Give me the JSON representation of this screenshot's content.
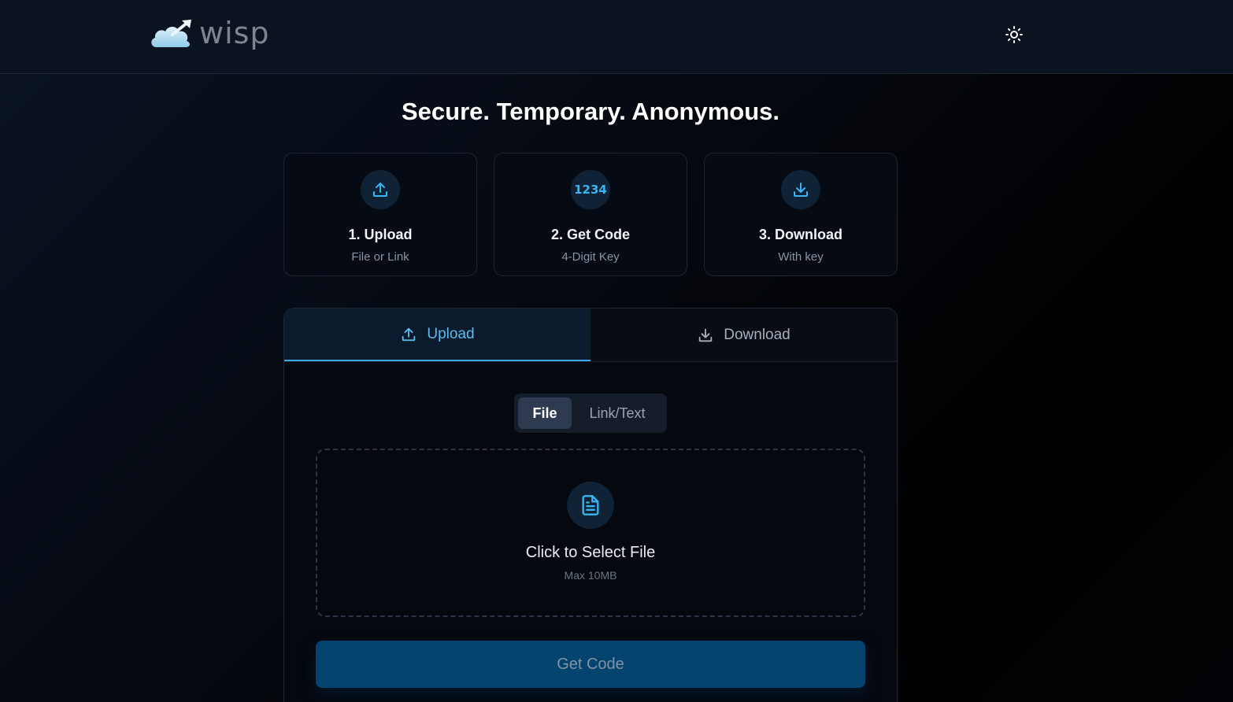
{
  "header": {
    "brand": "wisp",
    "logo_icon": "cloud-arrow-icon",
    "theme_toggle_icon": "sun-icon"
  },
  "hero": {
    "title": "Secure. Temporary. Anonymous."
  },
  "steps": [
    {
      "icon": "upload-icon",
      "title": "1. Upload",
      "subtitle": "File or Link"
    },
    {
      "icon_text": "1234",
      "title": "2. Get Code",
      "subtitle": "4-Digit Key"
    },
    {
      "icon": "download-icon",
      "title": "3. Download",
      "subtitle": "With key"
    }
  ],
  "tabs": [
    {
      "label": "Upload",
      "icon": "upload-icon",
      "active": true
    },
    {
      "label": "Download",
      "icon": "download-icon",
      "active": false
    }
  ],
  "mode_toggle": {
    "options": [
      "File",
      "Link/Text"
    ],
    "selected": "File"
  },
  "dropzone": {
    "icon": "file-text-icon",
    "title": "Click to Select File",
    "subtitle": "Max 10MB"
  },
  "cta": {
    "label": "Get Code"
  },
  "colors": {
    "accent": "#38b6f0",
    "cta_bg": "#05436f",
    "header_bg": "#0b1220"
  }
}
